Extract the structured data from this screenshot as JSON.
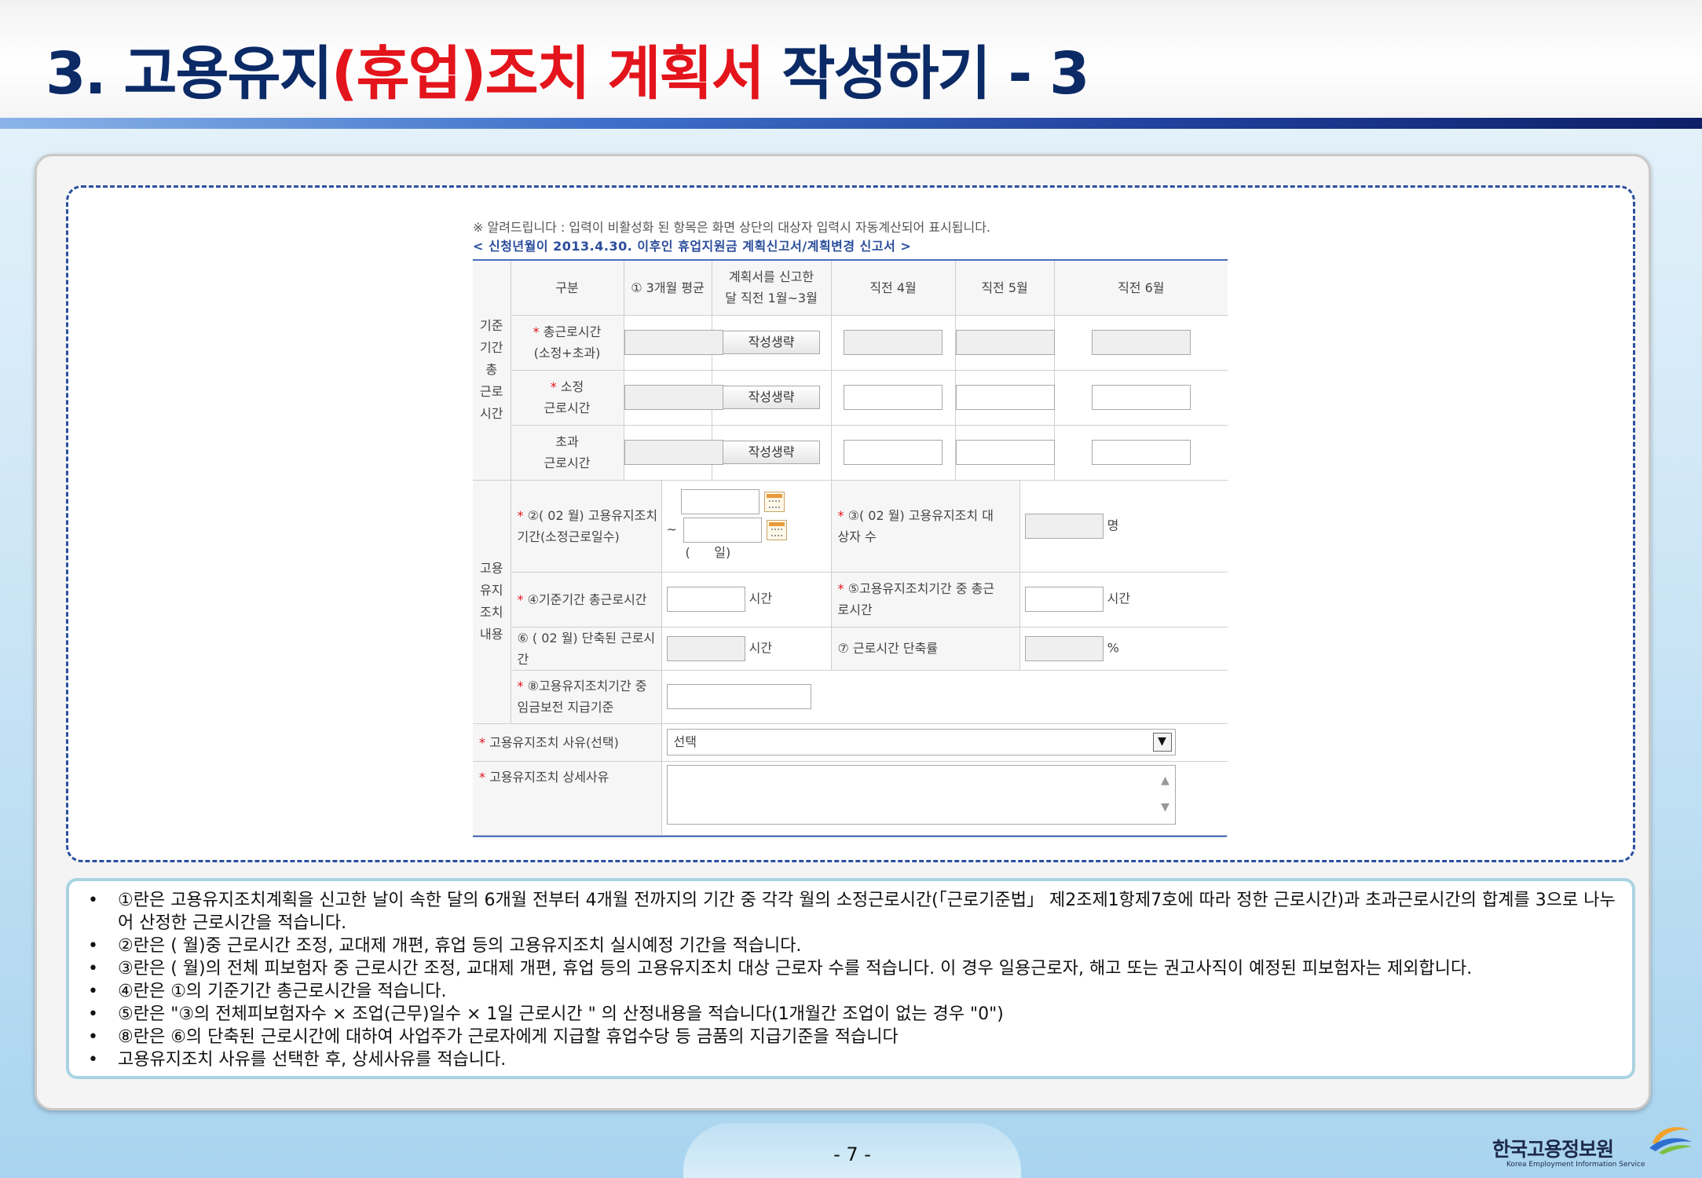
{
  "title": {
    "part1": "3. 고용유지",
    "part2": "(휴업)조치 계획서",
    "part3": " 작성하기 - 3"
  },
  "form": {
    "notice": "※ 알려드립니다 : 입력이 비활성화 된 항목은 화면 상단의 대상자 입력시 자동계산되어 표시됩니다.",
    "subtitle": "< 신청년월이 2013.4.30. 이후인 휴업지원금 계획신고서/계획변경 신고서 >",
    "group_base": "기준\n기간\n총\n근로\n시간",
    "group_plan": "고용\n유지\n조치\n내용",
    "headers": {
      "category": "구분",
      "avg": "① 3개월 평균",
      "recent13": "계획서를 신고한\n달 직전 1월~3월",
      "m4": "직전 4월",
      "m5": "직전 5월",
      "m6": "직전 6월"
    },
    "rows": {
      "total": "총근로시간\n(소정+초과)",
      "regular": "소정\n근로시간",
      "overtime": "초과\n근로시간"
    },
    "button_omit": "작성생략",
    "period_label": "②( 02 월) 고용유지조치\n기간(소정근로일수)",
    "tilde": "~",
    "days_text": "(      일)",
    "targets_label": "③( 02 월) 고용유지조치 대\n상자 수",
    "unit_persons": "명",
    "base_hours_label": "④기준기간 총근로시간",
    "unit_hours": "시간",
    "total_in_period_label": "⑤고용유지조치기간 중 총근\n로시간",
    "reduced_label": "⑥ ( 02 월) 단축된 근로시간",
    "reduction_rate_label": "⑦ 근로시간 단축률",
    "unit_percent": "%",
    "wage_label": "⑧고용유지조치기간 중\n임금보전 지급기준",
    "reason_label": "고용유지조치 사유(선택)",
    "reason_value": "선택",
    "detail_label": "고용유지조치 상세사유"
  },
  "notes": [
    "①란은 고용유지조치계획을 신고한 날이 속한 달의 6개월 전부터 4개월 전까지의 기간 중 각각 월의 소정근로시간(「근로기준법」 제2조제1항제7호에 따라 정한 근로시간)과 초과근로시간의 합계를 3으로 나누어 산정한 근로시간을 적습니다.",
    "②란은 ( 월)중 근로시간 조정, 교대제 개편, 휴업 등의 고용유지조치 실시예정 기간을 적습니다.",
    "③란은 ( 월)의 전체 피보험자 중 근로시간 조정, 교대제 개편, 휴업 등의 고용유지조치 대상 근로자 수를 적습니다. 이 경우 일용근로자, 해고 또는 권고사직이 예정된 피보험자는 제외합니다.",
    "④란은 ①의 기준기간 총근로시간을 적습니다.",
    "⑤란은 \"③의 전체피보험자수 × 조업(근무)일수 × 1일 근로시간 \" 의 산정내용을 적습니다(1개월간 조업이 없는 경우 \"0\")",
    "⑧란은 ⑥의 단축된 근로시간에 대하여 사업주가 근로자에게 지급할 휴업수당 등 금품의 지급기준을 적습니다",
    "고용유지조치 사유를 선택한 후, 상세사유를 적습니다."
  ],
  "footer": {
    "page_number": "- 7 -",
    "logo_text": "한국고용정보원",
    "logo_sub": "Korea Employment Information Service"
  },
  "colors": {
    "title_navy": "#0b2a66",
    "title_red": "#e3141b",
    "table_top_border": "#4a6fbd",
    "frame_dashed": "#2a4f9e"
  }
}
